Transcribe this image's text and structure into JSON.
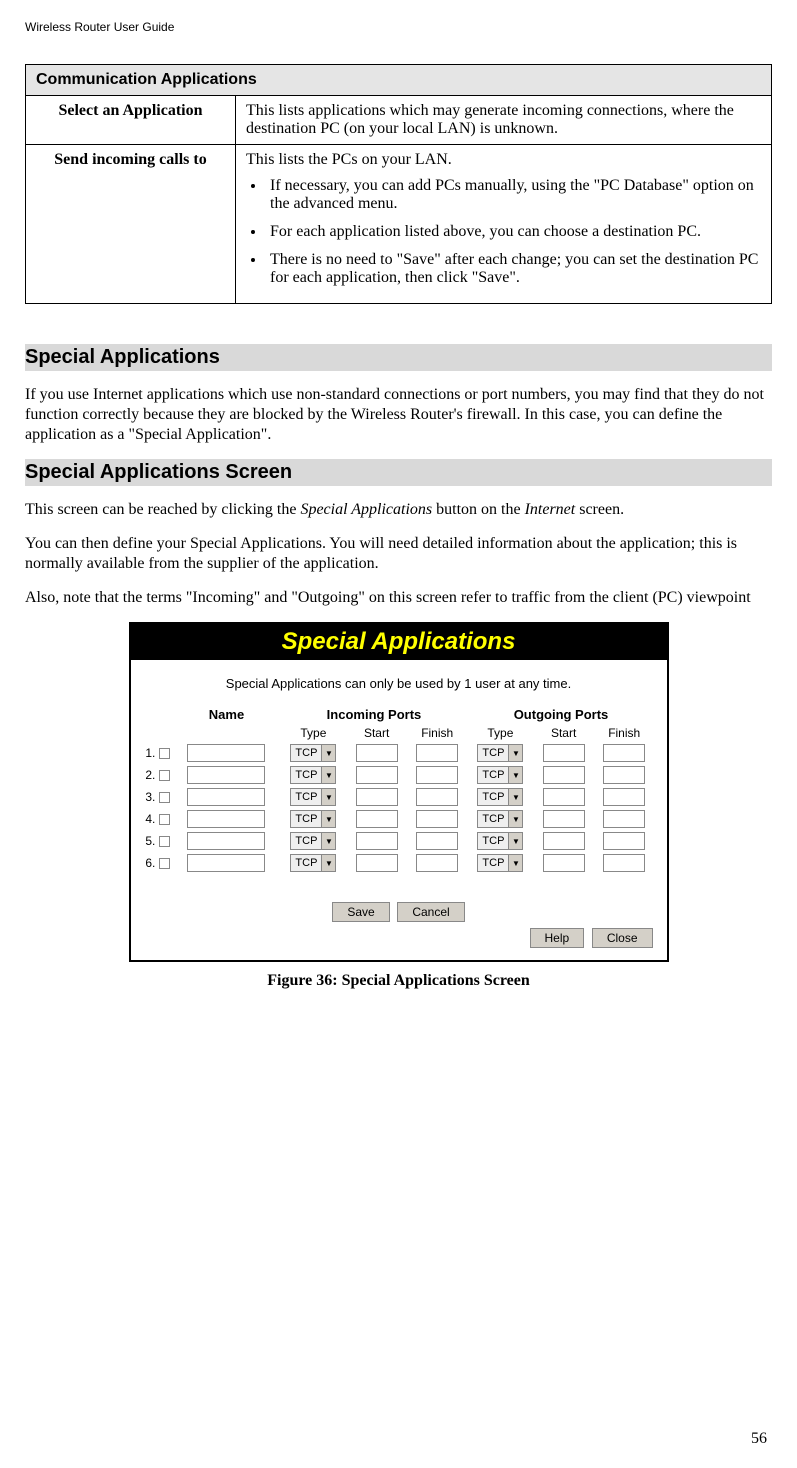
{
  "header": "Wireless Router User Guide",
  "table": {
    "title": "Communication Applications",
    "rows": [
      {
        "label": "Select an Application",
        "body": "This lists applications which may generate incoming connections, where the destination PC (on your local LAN) is unknown."
      },
      {
        "label": "Send incoming calls to",
        "body": "This lists the PCs on your LAN.",
        "bullets": [
          "If necessary, you can add PCs manually, using the \"PC Database\" option on the advanced menu.",
          "For each application listed above, you can choose a destination PC.",
          "There is no need to \"Save\" after each change; you can set the destination PC for each application, then click \"Save\"."
        ]
      }
    ]
  },
  "section1": {
    "title": "Special Applications",
    "para": "If you use Internet applications which use non-standard connections or port numbers, you may find that they do not function correctly because they are blocked by the Wireless Router's firewall. In this case, you can define the application as a \"Special Application\"."
  },
  "section2": {
    "title": "Special Applications Screen",
    "para1_pre": "This screen can be reached by clicking the ",
    "para1_em1": "Special Applications",
    "para1_mid": " button on the ",
    "para1_em2": "Internet",
    "para1_post": " screen.",
    "para2": "You can then define your Special Applications. You will need detailed information about the application; this is normally available from the supplier of the application.",
    "para3": "Also, note that the terms \"Incoming\" and \"Outgoing\" on this screen refer to traffic from the client (PC) viewpoint"
  },
  "app": {
    "title": "Special Applications",
    "desc": "Special Applications can only be used by 1 user at any time.",
    "columns": {
      "name": "Name",
      "incoming": "Incoming Ports",
      "outgoing": "Outgoing Ports",
      "type": "Type",
      "start": "Start",
      "finish": "Finish"
    },
    "dropdown_value": "TCP",
    "row_labels": [
      "1.",
      "2.",
      "3.",
      "4.",
      "5.",
      "6."
    ],
    "buttons": {
      "save": "Save",
      "cancel": "Cancel",
      "help": "Help",
      "close": "Close"
    }
  },
  "figure_caption": "Figure 36: Special Applications Screen",
  "page_number": "56"
}
